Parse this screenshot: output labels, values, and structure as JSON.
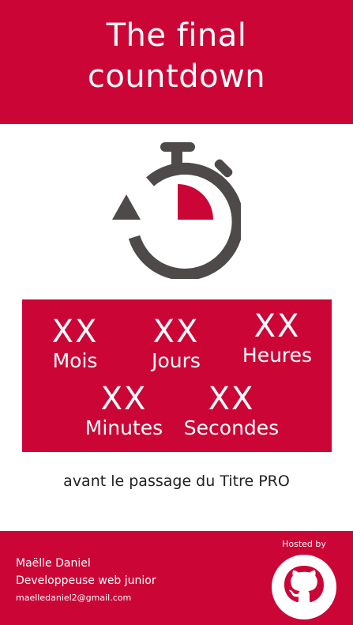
{
  "header": {
    "title_line1": "The final",
    "title_line2": "countdown"
  },
  "icons": {
    "timer": "stopwatch-icon",
    "host": "github-icon"
  },
  "countdown": {
    "months": {
      "value": "XX",
      "label": "Mois"
    },
    "days": {
      "value": "XX",
      "label": "Jours"
    },
    "hours": {
      "value": "XX",
      "label": "Heures"
    },
    "minutes": {
      "value": "XX",
      "label": "Minutes"
    },
    "seconds": {
      "value": "XX",
      "label": "Secondes"
    }
  },
  "tagline": "avant le passage du Titre PRO",
  "footer": {
    "name": "Maëlle Daniel",
    "role": "Developpeuse web junior",
    "email": "maelledaniel2@gmail.com",
    "hosted_label": "Hosted by"
  },
  "colors": {
    "brand_red": "#cc0537",
    "icon_gray": "#4f4a4a",
    "white": "#ffffff"
  }
}
